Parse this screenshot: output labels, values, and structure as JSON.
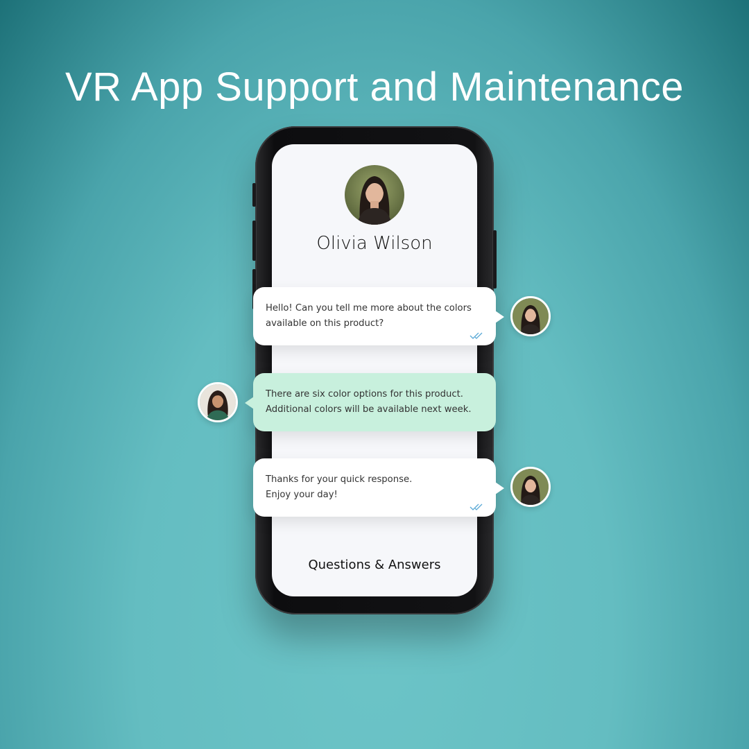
{
  "headline": "VR App Support and Maintenance",
  "profile": {
    "name": "Olivia Wilson",
    "avatar_icon": "woman-portrait"
  },
  "messages": [
    {
      "sender": "customer",
      "lines": [
        "Hello! Can you tell me more about the colors",
        "available on this product?"
      ],
      "status_icon": "double-check-icon"
    },
    {
      "sender": "support",
      "lines": [
        "There are six color options for this product.",
        "Additional colors will be available next week."
      ]
    },
    {
      "sender": "customer",
      "lines": [
        "Thanks for your quick response.",
        "Enjoy your day!"
      ],
      "status_icon": "double-check-icon"
    }
  ],
  "footer": "Questions & Answers",
  "colors": {
    "background": "#64bdc1",
    "customer_bubble": "#ffffff",
    "support_bubble": "#c8f0dd",
    "check_mark": "#5aa9d6"
  }
}
